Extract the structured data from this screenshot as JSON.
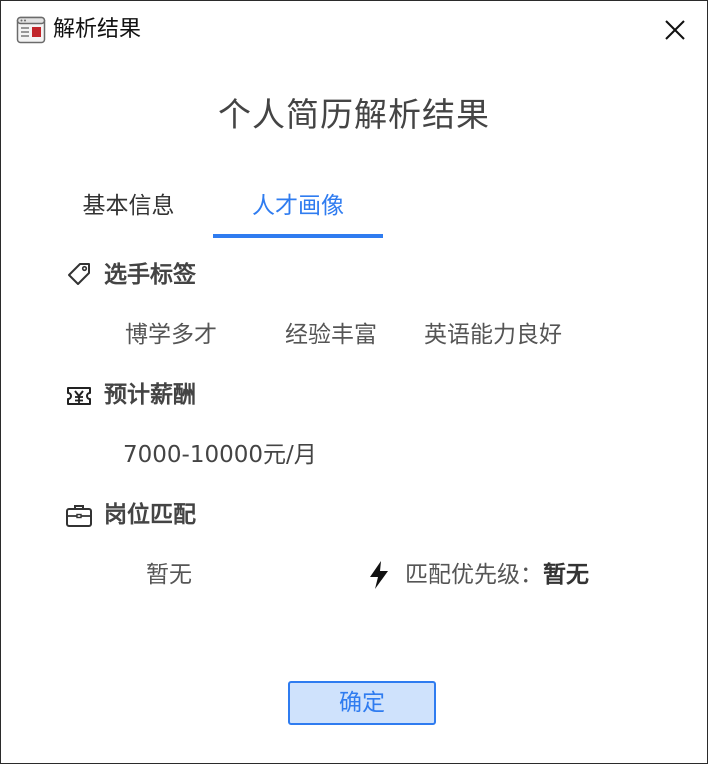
{
  "window": {
    "title": "解析结果"
  },
  "heading": "个人简历解析结果",
  "tabs": [
    {
      "label": "基本信息",
      "active": false
    },
    {
      "label": "人才画像",
      "active": true
    }
  ],
  "sections": {
    "tags": {
      "label": "选手标签",
      "icon": "tag-icon",
      "items": [
        "博学多才",
        "经验丰富",
        "英语能力良好"
      ]
    },
    "salary": {
      "label": "预计薪酬",
      "icon": "yuan-ticket-icon",
      "value": "7000-10000元/月"
    },
    "position": {
      "label": "岗位匹配",
      "icon": "briefcase-icon",
      "value": "暂无",
      "priority_label": "匹配优先级：",
      "priority_value": "暂无",
      "priority_icon": "lightning-bolt-icon"
    }
  },
  "footer": {
    "ok_label": "确定"
  },
  "colors": {
    "accent": "#2f7cf0",
    "button_bg": "#cfe2fc",
    "text": "#333333"
  }
}
